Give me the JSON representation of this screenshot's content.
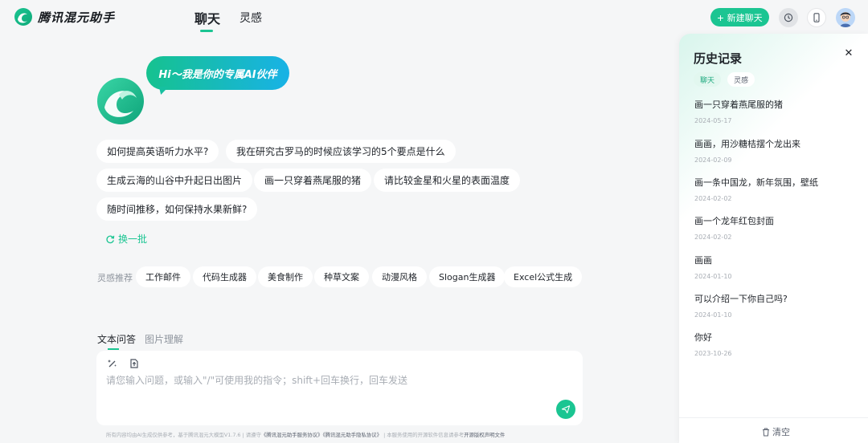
{
  "header": {
    "brand": "腾讯混元助手",
    "tabs": [
      {
        "label": "聊天",
        "active": true
      },
      {
        "label": "灵感",
        "active": false
      }
    ],
    "new_chat_label": "新建聊天"
  },
  "welcome": {
    "greeting": "Hi～我是你的专属AI伙伴",
    "suggestions": [
      "如何提高英语听力水平?",
      "我在研究古罗马的时候应该学习的5个要点是什么",
      "生成云海的山谷中升起日出图片",
      "画一只穿着燕尾服的猪",
      "请比较金星和火星的表面温度",
      "随时间推移，如何保持水果新鲜?"
    ],
    "refresh_label": "换一批"
  },
  "inspiration": {
    "label": "灵感推荐",
    "items": [
      "工作邮件",
      "代码生成器",
      "美食制作",
      "种草文案",
      "动漫风格",
      "Slogan生成器",
      "Excel公式生成"
    ]
  },
  "composer": {
    "modes": [
      {
        "label": "文本问答",
        "active": true
      },
      {
        "label": "图片理解",
        "active": false
      }
    ],
    "placeholder": "请您输入问题，或输入\"/\"可使用我的指令；shift+回车换行，回车发送",
    "value": ""
  },
  "footer": {
    "prefix": "所有内容均由AI生成仅供参考，基于腾讯混元大模型V1.7.6 | 请遵守",
    "service_link": "《腾讯混元助手服务协议》",
    "privacy_link": "《腾讯混元助手隐私协议》",
    "middle": " | 本服务使用的开源软件信息请参考",
    "license_link": "开源版权声明文件"
  },
  "history": {
    "title": "历史记录",
    "tabs": [
      {
        "label": "聊天",
        "active": true
      },
      {
        "label": "灵感",
        "active": false
      }
    ],
    "items": [
      {
        "title": "画一只穿着燕尾服的猪",
        "date": "2024-05-17"
      },
      {
        "title": "画画，用沙糖桔摆个龙出来",
        "date": "2024-02-09"
      },
      {
        "title": "画一条中国龙，新年氛围，壁纸",
        "date": "2024-02-02"
      },
      {
        "title": "画一个龙年红包封面",
        "date": "2024-02-02"
      },
      {
        "title": "画画",
        "date": "2024-01-10"
      },
      {
        "title": "可以介绍一下你自己吗?",
        "date": "2024-01-10"
      },
      {
        "title": "你好",
        "date": "2023-10-26"
      }
    ],
    "clear_label": "清空"
  },
  "colors": {
    "accent": "#1bc592",
    "accent_blue": "#18b2e6",
    "background": "#f5f6f7"
  },
  "icons": {
    "brand": "hunyuan-logo-icon",
    "new_chat": "plus-icon",
    "history": "history-clock-icon",
    "mobile": "mobile-phone-icon",
    "refresh": "refresh-icon",
    "tool_1": "magic-wand-icon",
    "tool_2": "upload-file-icon",
    "send": "send-icon",
    "close": "close-icon",
    "clear": "trash-icon"
  }
}
